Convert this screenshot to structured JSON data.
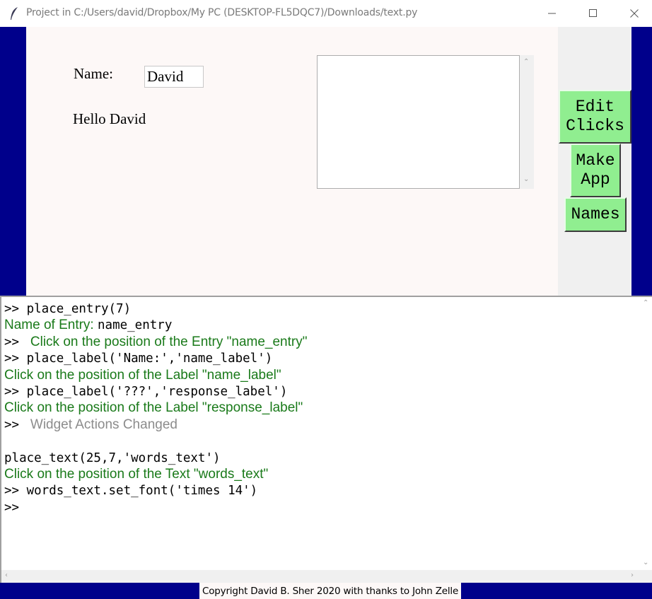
{
  "window": {
    "title": "Project in C:/Users/david/Dropbox/My PC (DESKTOP-FL5DQC7)/Downloads/text.py",
    "minimize_glyph": "—",
    "maximize_glyph": "☐",
    "close_glyph": "✕"
  },
  "canvas": {
    "name_label": "Name:",
    "name_entry_value": "David",
    "response_label": "Hello David"
  },
  "buttons": {
    "edit_clicks": "Edit\nClicks",
    "make_app": "Make\nApp",
    "names": "Names"
  },
  "console": {
    "lines": [
      {
        "style": "mono",
        "text": ">> place_entry(7)"
      },
      {
        "style": "mixed",
        "text_green": "Name of Entry: ",
        "text_mono": "name_entry"
      },
      {
        "style": "prompt-green",
        "prompt": ">> ",
        "text": " Click on the position of the Entry \"name_entry\""
      },
      {
        "style": "mono",
        "text": ">> place_label('Name:','name_label')"
      },
      {
        "style": "green",
        "text": "Click on the position of the Label \"name_label\""
      },
      {
        "style": "mono",
        "text": ">> place_label('???','response_label')"
      },
      {
        "style": "green",
        "text": "Click on the position of the Label \"response_label\""
      },
      {
        "style": "prompt-gray",
        "prompt": ">> ",
        "text": " Widget Actions Changed"
      },
      {
        "style": "mono",
        "text": ""
      },
      {
        "style": "mono",
        "text": "place_text(25,7,'words_text')"
      },
      {
        "style": "green",
        "text": "Click on the position of the Text \"words_text\""
      },
      {
        "style": "mono",
        "text": ">> words_text.set_font('times 14')"
      },
      {
        "style": "mono",
        "text": ">>"
      }
    ]
  },
  "footer": {
    "text": "Copyright David B. Sher 2020 with thanks to John Zelle"
  },
  "colors": {
    "side_blue": "#00008b",
    "button_green": "#90ee90",
    "console_green": "#1a7a1a",
    "console_gray": "#8c8c8c",
    "canvas_bg": "#fdf8f7"
  }
}
